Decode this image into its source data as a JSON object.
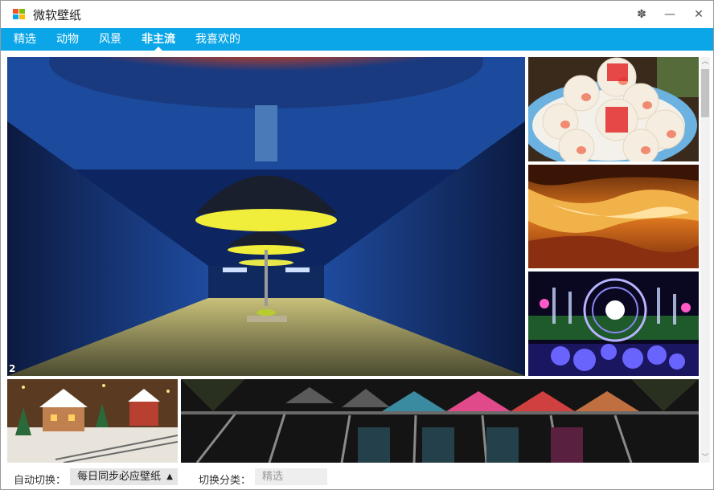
{
  "window": {
    "title": "微软壁纸",
    "buttons": {
      "settings": "✽",
      "minimize": "—",
      "close": "✕"
    }
  },
  "nav": {
    "tabs": [
      {
        "label": "精选",
        "active": false
      },
      {
        "label": "动物",
        "active": false
      },
      {
        "label": "风景",
        "active": false
      },
      {
        "label": "非主流",
        "active": true
      },
      {
        "label": "我喜欢的",
        "active": false
      }
    ]
  },
  "gallery": {
    "page_number": "2",
    "tiles": [
      {
        "subject": "subway-station-lamps"
      },
      {
        "subject": "pig-buns"
      },
      {
        "subject": "antelope-canyon"
      },
      {
        "subject": "light-spheres-garden"
      },
      {
        "subject": "christmas-village"
      },
      {
        "subject": "glass-dome-ceiling"
      }
    ]
  },
  "scrollbar": {
    "up": "︿",
    "down": "﹀"
  },
  "footer": {
    "auto_switch_label": "自动切换：",
    "auto_switch_value": "每日同步必应壁纸",
    "auto_switch_arrow": "▲",
    "category_label": "切换分类：",
    "category_value": "精选"
  },
  "colors": {
    "accent": "#0aa6e8",
    "nav_text": "#ffffff",
    "select_bg": "#e6e6e6"
  }
}
